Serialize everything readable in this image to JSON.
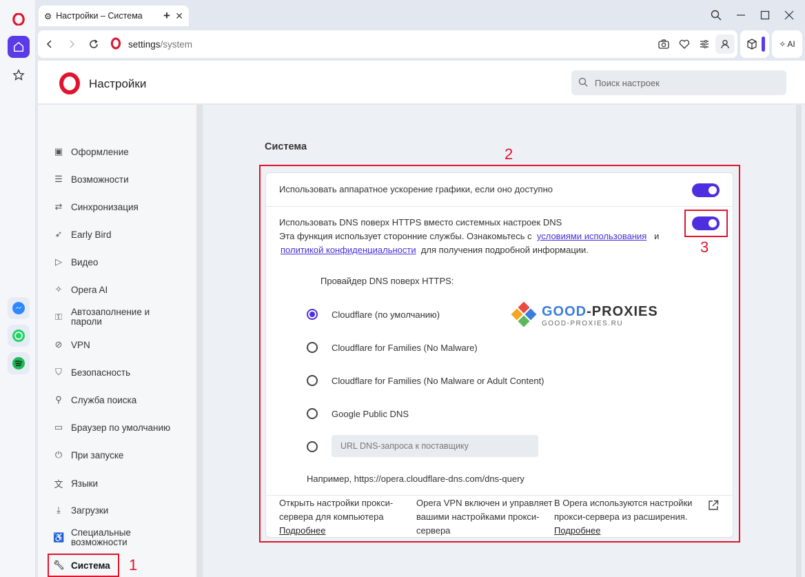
{
  "window": {
    "tab_title": "Настройки – Система",
    "url_host": "settings",
    "url_path": "/system",
    "ai_label": "AI"
  },
  "header": {
    "title": "Настройки",
    "search_placeholder": "Поиск настроек"
  },
  "sidebar": {
    "items": [
      {
        "label": "Оформление",
        "icon": "image-icon"
      },
      {
        "label": "Возможности",
        "icon": "list-icon"
      },
      {
        "label": "Синхронизация",
        "icon": "sync-icon"
      },
      {
        "label": "Early Bird",
        "icon": "bird-icon"
      },
      {
        "label": "Видео",
        "icon": "play-icon"
      },
      {
        "label": "Opera AI",
        "icon": "sparkle-icon"
      },
      {
        "label": "Автозаполнение и пароли",
        "icon": "key-icon"
      },
      {
        "label": "VPN",
        "icon": "vpn-icon"
      },
      {
        "label": "Безопасность",
        "icon": "shield-icon"
      },
      {
        "label": "Служба поиска",
        "icon": "search-icon"
      },
      {
        "label": "Браузер по умолчанию",
        "icon": "browser-icon"
      },
      {
        "label": "При запуске",
        "icon": "power-icon"
      },
      {
        "label": "Языки",
        "icon": "language-icon"
      },
      {
        "label": "Загрузки",
        "icon": "download-icon"
      },
      {
        "label": "Специальные возможности",
        "icon": "accessibility-icon"
      },
      {
        "label": "Система",
        "icon": "wrench-icon"
      }
    ]
  },
  "main": {
    "section_title": "Система",
    "hw_accel_label": "Использовать аппаратное ускорение графики, если оно доступно",
    "doh_title": "Использовать DNS поверх HTTPS вместо системных настроек DNS",
    "doh_desc_1": "Эта функция использует сторонние службы. Ознакомьтесь с",
    "doh_link_terms": "условиями использования",
    "doh_desc_and": "и",
    "doh_link_privacy": "политикой конфиденциальности",
    "doh_desc_2": "для получения подробной информации.",
    "provider_label": "Провайдер DNS поверх HTTPS:",
    "providers": [
      {
        "label": "Cloudflare (по умолчанию)",
        "selected": true
      },
      {
        "label": "Cloudflare for Families (No Malware)",
        "selected": false
      },
      {
        "label": "Cloudflare for Families (No Malware or Adult Content)",
        "selected": false
      },
      {
        "label": "Google Public DNS",
        "selected": false
      }
    ],
    "custom_placeholder": "URL DNS-запроса к поставщику",
    "example_text": "Например, https://opera.cloudflare-dns.com/dns-query",
    "footer": {
      "col1_text": "Открыть настройки прокси-сервера для компьютера",
      "col1_link": "Подробнее",
      "col2_text": "Opera VPN включен и управляет вашими настройками прокси-сервера",
      "col3_text": "В Opera используются настройки прокси-сервера из расширения.",
      "col3_link": "Подробнее"
    }
  },
  "watermark": {
    "brand_1": "GOOD",
    "brand_2": "-PROXIES",
    "domain": "GOOD-PROXIES.RU"
  },
  "annotations": {
    "n1": "1",
    "n2": "2",
    "n3": "3"
  },
  "colors": {
    "accent": "#4e2fe0",
    "annotation": "#e0142c",
    "opera_red": "#e0142c"
  }
}
